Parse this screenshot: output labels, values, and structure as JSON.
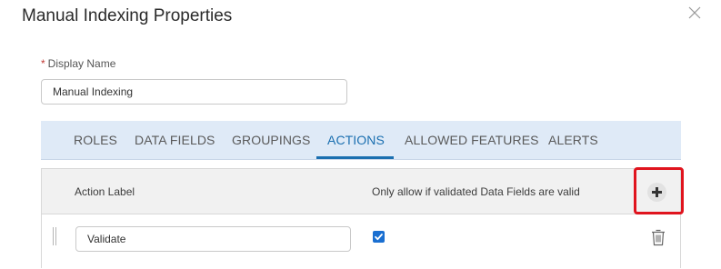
{
  "dialog": {
    "title": "Manual Indexing Properties",
    "close_icon": "close-icon"
  },
  "display_name": {
    "required_marker": "*",
    "label": "Display Name",
    "value": "Manual Indexing"
  },
  "tabs": [
    {
      "label": "ROLES",
      "active": false
    },
    {
      "label": "DATA FIELDS",
      "active": false
    },
    {
      "label": "GROUPINGS",
      "active": false
    },
    {
      "label": "ACTIONS",
      "active": true
    },
    {
      "label": "ALLOWED FEATURES",
      "active": false
    },
    {
      "label": "ALERTS",
      "active": false
    }
  ],
  "actions_table": {
    "columns": [
      "Action Label",
      "Only allow if validated Data Fields are valid"
    ],
    "add_icon": "plus-circle-icon",
    "rows": [
      {
        "action_label": "Validate",
        "only_if_valid": true,
        "delete_icon": "trash-icon"
      }
    ]
  },
  "colors": {
    "accent": "#1a6fb0",
    "tab_bar_bg": "#dfeaf7",
    "highlight": "#e0141e",
    "checkbox": "#1a6fd1"
  }
}
